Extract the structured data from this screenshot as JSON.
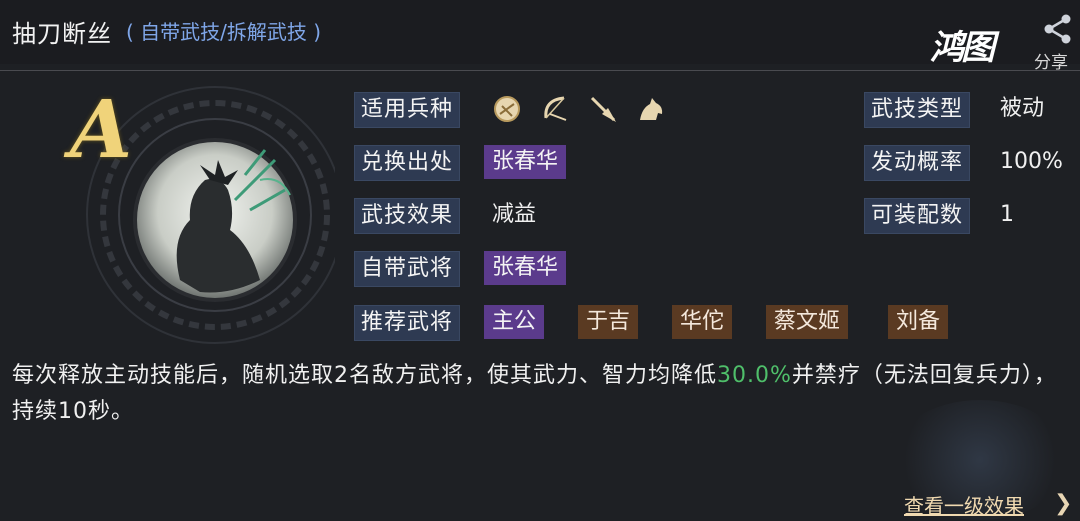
{
  "header": {
    "title": "抽刀断丝",
    "subtitle": "( 自带武技/拆解武技 )",
    "share_label": "分享",
    "logo_text": "鸿图"
  },
  "portrait": {
    "grade": "A"
  },
  "rows": {
    "troop": {
      "label": "适用兵种",
      "icons": [
        "shield-icon",
        "bow-icon",
        "spear-icon",
        "horse-icon"
      ]
    },
    "source": {
      "label": "兑换出处",
      "value": "张春华"
    },
    "effect": {
      "label": "武技效果",
      "value": "减益"
    },
    "own_general": {
      "label": "自带武将",
      "value": "张春华"
    },
    "recommended": {
      "label": "推荐武将",
      "values": [
        "主公",
        "于吉",
        "华佗",
        "蔡文姬",
        "刘备"
      ]
    },
    "skill_type": {
      "label": "武技类型",
      "value": "被动"
    },
    "trigger_rate": {
      "label": "发动概率",
      "value": "100%"
    },
    "equip_count": {
      "label": "可装配数",
      "value": "1"
    }
  },
  "description": {
    "part1": "每次释放主动技能后，随机选取2名敌方武将，使其武力、智力均降低",
    "highlight": "30.0%",
    "part2": "并禁疗（无法回复兵力），持续10秒。"
  },
  "footer": {
    "link_label": "查看一级效果"
  },
  "colors": {
    "highlight": "#4fbf6a",
    "label_bg": "#2e3a52",
    "tag_purple": "#5b3b8c",
    "tag_brown": "#5a3a22"
  }
}
